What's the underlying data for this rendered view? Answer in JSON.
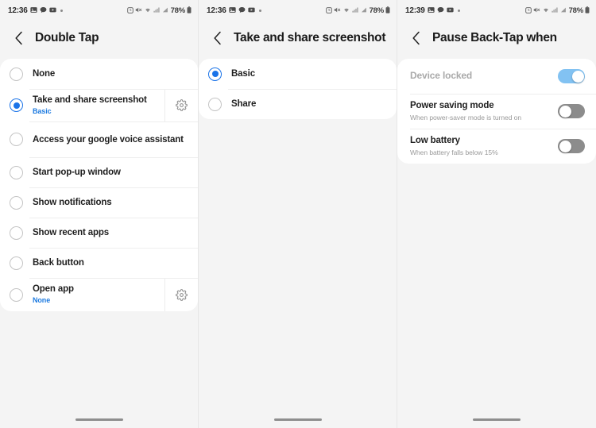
{
  "panels": [
    {
      "status_bar": {
        "time": "12:36",
        "icons": [
          "gallery-icon",
          "chat-icon",
          "video-icon",
          "dot-icon"
        ],
        "right_icons": [
          "alarm-icon",
          "mute-icon",
          "wifi-icon",
          "signal1-icon",
          "signal2-icon"
        ],
        "battery": "78%"
      },
      "header": {
        "back": "back-arrow-icon",
        "title": "Double Tap"
      },
      "type": "radio-list",
      "items": [
        {
          "label": "None",
          "sub": null,
          "selected": false,
          "gear": false
        },
        {
          "label": "Take and share screenshot",
          "sub": "Basic",
          "selected": true,
          "gear": true
        },
        {
          "label": "Access your google voice assistant",
          "sub": null,
          "selected": false,
          "gear": false
        },
        {
          "label": "Start pop-up window",
          "sub": null,
          "selected": false,
          "gear": false
        },
        {
          "label": "Show notifications",
          "sub": null,
          "selected": false,
          "gear": false
        },
        {
          "label": "Show recent apps",
          "sub": null,
          "selected": false,
          "gear": false
        },
        {
          "label": "Back button",
          "sub": null,
          "selected": false,
          "gear": false
        },
        {
          "label": "Open app",
          "sub": "None",
          "selected": false,
          "gear": true
        }
      ]
    },
    {
      "status_bar": {
        "time": "12:36",
        "battery": "78%"
      },
      "header": {
        "back": "back-arrow-icon",
        "title": "Take and share screenshot"
      },
      "type": "radio-list",
      "items": [
        {
          "label": "Basic",
          "sub": null,
          "selected": true,
          "gear": false
        },
        {
          "label": "Share",
          "sub": null,
          "selected": false,
          "gear": false
        }
      ]
    },
    {
      "status_bar": {
        "time": "12:39",
        "battery": "78%"
      },
      "header": {
        "back": "back-arrow-icon",
        "title": "Pause Back-Tap when"
      },
      "type": "toggle-list",
      "items": [
        {
          "label": "Device locked",
          "sub": null,
          "on": true,
          "disabled": true
        },
        {
          "label": "Power saving mode",
          "sub": "When power-saver mode is turned on",
          "on": false,
          "disabled": false
        },
        {
          "label": "Low battery",
          "sub": "When battery falls below 15%",
          "on": false,
          "disabled": false
        }
      ]
    }
  ],
  "colors": {
    "accent": "#1a73e8",
    "sub_link": "#1e7be0",
    "toggle_on": "#82c2f2",
    "toggle_off": "#8c8c8c",
    "background": "#f4f4f4",
    "card": "#ffffff"
  }
}
